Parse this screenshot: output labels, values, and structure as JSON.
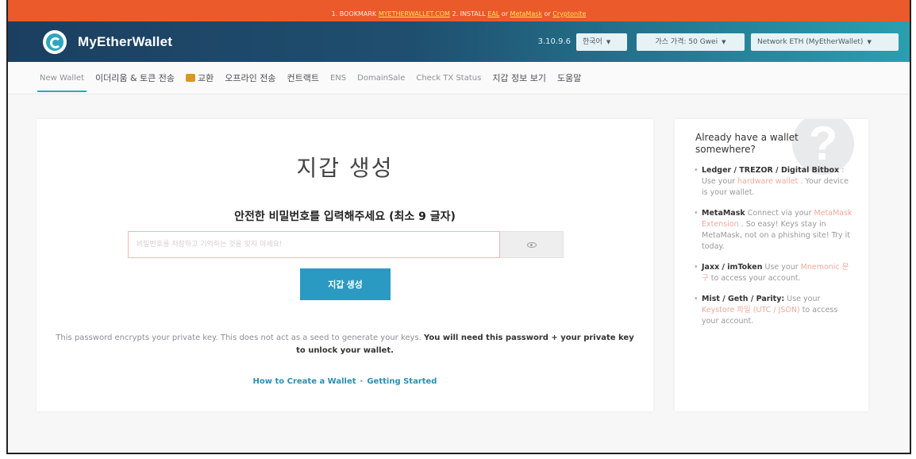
{
  "banner": {
    "prefix": "1. BOOKMARK ",
    "bookmark_link": "MYETHERWALLET.COM",
    "middle": "   2. INSTALL ",
    "link_eal": "EAL",
    "or1": " or ",
    "link_metamask": "MetaMask",
    "or2": " or ",
    "link_cryptonite": "Cryptonite"
  },
  "header": {
    "brand": "MyEtherWallet",
    "version": "3.10.9.6",
    "language": "한국어",
    "gas_price": "가스 가격: 50 Gwei",
    "network": "Network ETH (MyEtherWallet)"
  },
  "nav": {
    "items": [
      {
        "label": "New Wallet",
        "active": true
      },
      {
        "label": "이더리움 & 토큰 전송"
      },
      {
        "label": "교환",
        "icon": "swap-icon"
      },
      {
        "label": "오프라인 전송"
      },
      {
        "label": "컨트랙트"
      },
      {
        "label": "ENS"
      },
      {
        "label": "DomainSale"
      },
      {
        "label": "Check TX Status"
      },
      {
        "label": "지갑 정보 보기"
      },
      {
        "label": "도움말"
      }
    ]
  },
  "main": {
    "title": "지갑 생성",
    "subtitle": "안전한 비밀번호를 입력해주세요 (최소 9 글자)",
    "password_placeholder": "비밀번호를 저장하고 기억하는 것을 잊지 마세요!",
    "create_button": "지갑 생성",
    "note_plain": "This password encrypts your private key. This does not act as a seed to generate your keys. ",
    "note_bold": "You will need this password + your private key to unlock your wallet.",
    "link_how_to": "How to Create a Wallet",
    "link_separator": "·",
    "link_getting_started": "Getting Started"
  },
  "sidebar": {
    "question_mark": "?",
    "title": "Already have a wallet somewhere?",
    "items": [
      {
        "bold": "Ledger / TREZOR / Digital Bitbox",
        "pre": " : Use your ",
        "hl": "hardware wallet",
        "post": " . Your device is your wallet."
      },
      {
        "bold": "MetaMask",
        "pre": " Connect via your ",
        "hl": "MetaMask Extension",
        "post": " . So easy! Keys stay in MetaMask, not on a phishing site! Try it today."
      },
      {
        "bold": "Jaxx / imToken",
        "pre": " Use your ",
        "hl": "Mnemonic 문구",
        "post": " to access your account."
      },
      {
        "bold": "Mist / Geth / Parity:",
        "pre": " Use your ",
        "hl": "Keystore 파일 (UTC / JSON)",
        "post": " to access your account."
      }
    ]
  }
}
